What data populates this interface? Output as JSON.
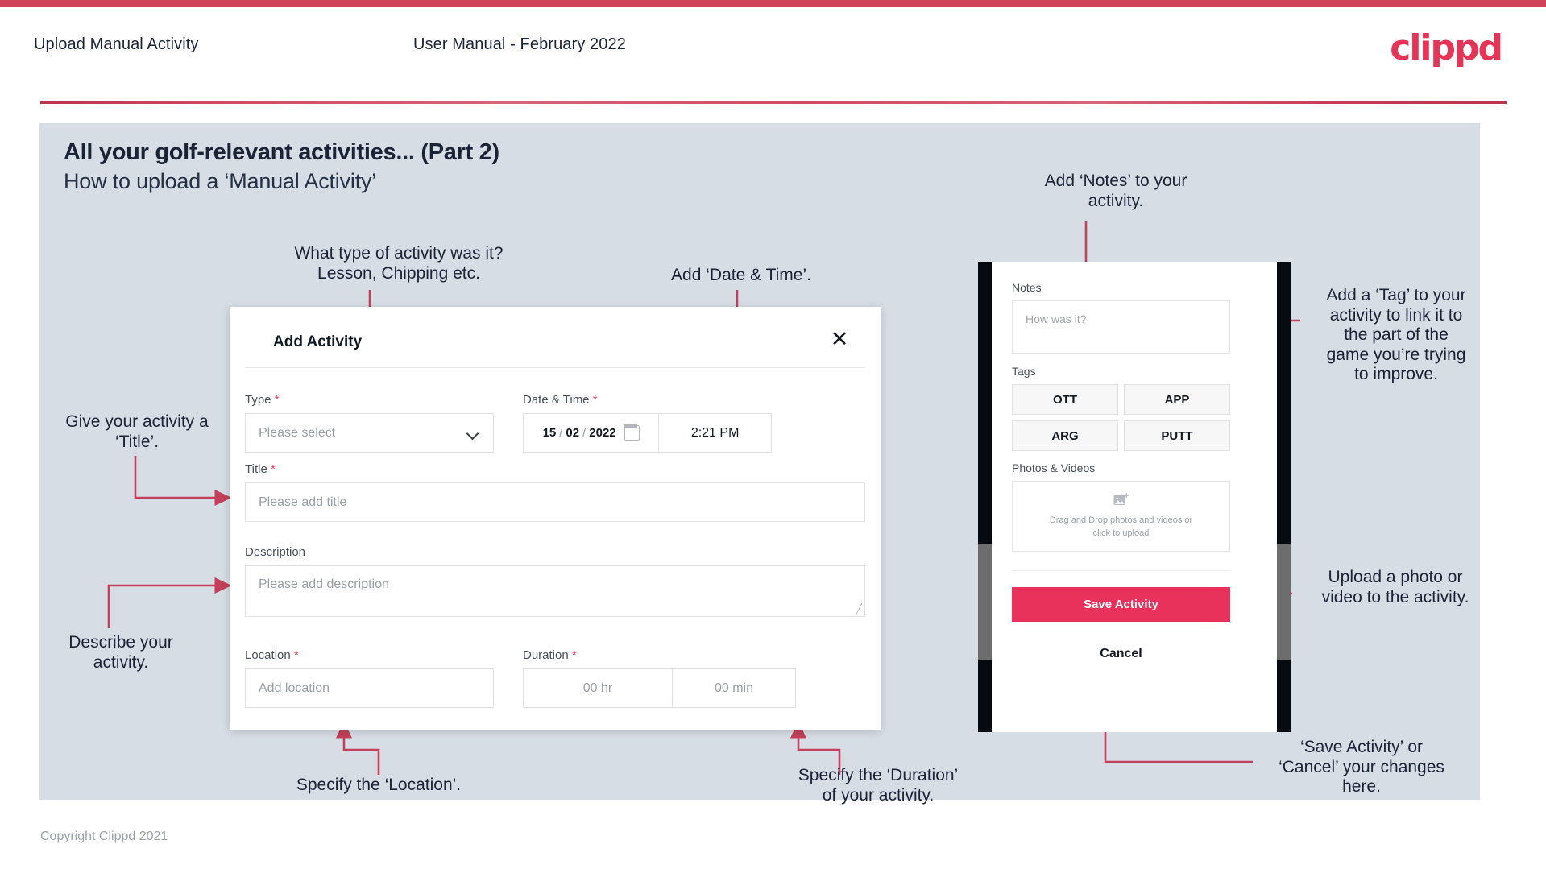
{
  "header": {
    "title": "Upload Manual Activity",
    "subtitle": "User Manual - February 2022",
    "logo": "clippd"
  },
  "slide": {
    "heading": "All your golf-relevant activities... (Part 2)",
    "subheading": "How to upload a ‘Manual Activity’"
  },
  "annotations": {
    "type": "What type of activity was it?\nLesson, Chipping etc.",
    "datetime": "Add ‘Date & Time’.",
    "title": "Give your activity a\n‘Title’.",
    "description": "Describe your\nactivity.",
    "location": "Specify the ‘Location’.",
    "duration": "Specify the ‘Duration’\nof your activity.",
    "notes": "Add ‘Notes’ to your\nactivity.",
    "tag": "Add a ‘Tag’ to your\nactivity to link it to\nthe part of the\ngame you’re trying\nto improve.",
    "upload": "Upload a photo or\nvideo to the activity.",
    "save": "‘Save Activity’ or\n‘Cancel’ your changes\nhere."
  },
  "modal": {
    "title": "Add Activity",
    "close_icon": "close-icon",
    "fields": {
      "type": {
        "label": "Type",
        "required": "*",
        "placeholder": "Please select"
      },
      "datetime": {
        "label": "Date & Time",
        "required": "*",
        "day": "15",
        "sep1": "/",
        "month": "02",
        "sep2": "/",
        "year": "2022",
        "time": "2:21 PM"
      },
      "title": {
        "label": "Title",
        "required": "*",
        "placeholder": "Please add title"
      },
      "description": {
        "label": "Description",
        "required": "",
        "placeholder": "Please add description"
      },
      "location": {
        "label": "Location",
        "required": "*",
        "placeholder": "Add location"
      },
      "duration": {
        "label": "Duration",
        "required": "*",
        "hours": "00 hr",
        "minutes": "00 min"
      }
    }
  },
  "phone": {
    "notes": {
      "label": "Notes",
      "placeholder": "How was it?"
    },
    "tags": {
      "label": "Tags",
      "items": [
        "OTT",
        "APP",
        "ARG",
        "PUTT"
      ]
    },
    "media": {
      "label": "Photos & Videos",
      "dropzone_line1": "Drag and Drop photos and videos or",
      "dropzone_line2": "click to upload",
      "icon": "add-image-icon"
    },
    "save_label": "Save Activity",
    "cancel_label": "Cancel"
  },
  "footer": {
    "copyright": "Copyright Clippd 2021"
  },
  "colors": {
    "accent": "#e8315b",
    "brand": "#e63356",
    "panel": "#d7dde5",
    "ink": "#1b2436"
  }
}
